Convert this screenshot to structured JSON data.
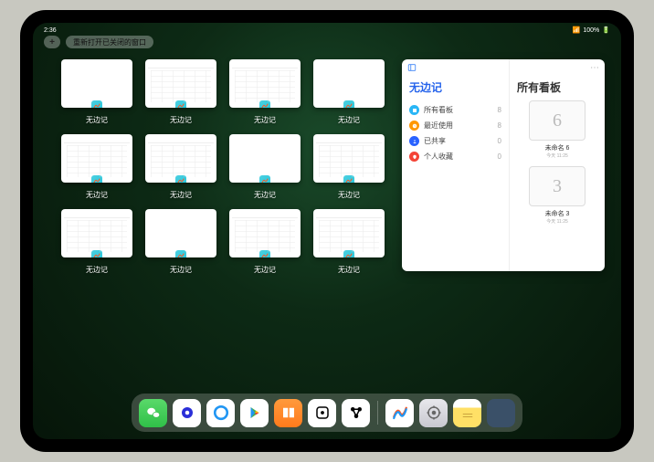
{
  "status": {
    "time": "2:36",
    "battery": "100%",
    "signal": "●●●●"
  },
  "top": {
    "plus": "+",
    "reopen_label": "重新打开已关闭的窗口"
  },
  "app_name": "无边记",
  "windows": [
    {
      "label": "无边记",
      "variant": "blank"
    },
    {
      "label": "无边记",
      "variant": "toolbar"
    },
    {
      "label": "无边记",
      "variant": "toolbar"
    },
    {
      "label": "无边记",
      "variant": "blank"
    },
    {
      "label": "无边记",
      "variant": "toolbar"
    },
    {
      "label": "无边记",
      "variant": "toolbar"
    },
    {
      "label": "无边记",
      "variant": "blank"
    },
    {
      "label": "无边记",
      "variant": "toolbar"
    },
    {
      "label": "无边记",
      "variant": "toolbar"
    },
    {
      "label": "无边记",
      "variant": "blank"
    },
    {
      "label": "无边记",
      "variant": "toolbar"
    },
    {
      "label": "无边记",
      "variant": "toolbar"
    }
  ],
  "panel": {
    "sidebar_title": "无边记",
    "items": [
      {
        "icon_color": "#29b6f6",
        "label": "所有看板",
        "count": "8"
      },
      {
        "icon_color": "#ff9800",
        "label": "最近使用",
        "count": "8"
      },
      {
        "icon_color": "#2962ff",
        "label": "已共享",
        "count": "0"
      },
      {
        "icon_color": "#f44336",
        "label": "个人收藏",
        "count": "0"
      }
    ],
    "content_title": "所有看板",
    "boards": [
      {
        "glyph": "6",
        "name": "未命名 6",
        "date": "今天 11:25"
      },
      {
        "glyph": "3",
        "name": "未命名 3",
        "date": "今天 11:25"
      }
    ]
  },
  "dock": [
    {
      "name": "wechat",
      "cls": "di-wechat"
    },
    {
      "name": "quark",
      "cls": "di-quark"
    },
    {
      "name": "qq-browser",
      "cls": "di-qqb"
    },
    {
      "name": "play",
      "cls": "di-play"
    },
    {
      "name": "books",
      "cls": "di-books"
    },
    {
      "name": "dice",
      "cls": "di-dice"
    },
    {
      "name": "control",
      "cls": "di-ctrl"
    },
    {
      "name": "freeform",
      "cls": "di-freeform"
    },
    {
      "name": "settings",
      "cls": "di-settings"
    },
    {
      "name": "notes",
      "cls": "di-notes"
    },
    {
      "name": "recent-folder",
      "cls": "di-folder"
    }
  ]
}
